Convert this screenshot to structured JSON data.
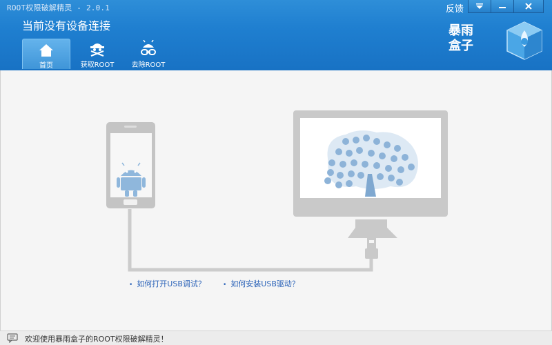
{
  "window": {
    "title": "ROOT权限破解精灵 - 2.0.1",
    "feedback_label": "反馈",
    "controls": {
      "menu": "▾",
      "minimize": "—",
      "close": "✕"
    }
  },
  "header": {
    "status": "当前没有设备连接",
    "brand_line1": "暴雨",
    "brand_line2": "盒子"
  },
  "nav": {
    "tabs": [
      {
        "label": "首页",
        "icon": "home-icon",
        "active": true
      },
      {
        "label": "获取ROOT",
        "icon": "android-pirate-icon",
        "active": false
      },
      {
        "label": "去除ROOT",
        "icon": "android-chain-icon",
        "active": false
      }
    ]
  },
  "help_links": [
    {
      "label": "如何打开USB调试？"
    },
    {
      "label": "如何安装USB驱动？"
    }
  ],
  "statusbar": {
    "message": "欢迎使用暴雨盒子的ROOT权限破解精灵！"
  },
  "colors": {
    "header": "#1f7fd0",
    "link": "#2a62b8",
    "illustration": "#c9c9c9"
  }
}
